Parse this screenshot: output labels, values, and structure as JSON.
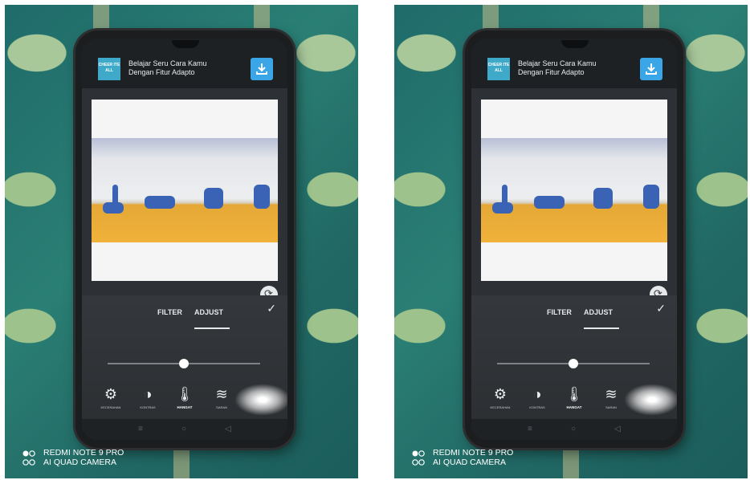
{
  "app": {
    "title_line1": "Belajar Seru Cara Kamu",
    "title_line2": "Dengan Fitur Adapto",
    "logo_text": "CHEER ITE ALL"
  },
  "editor": {
    "tabs": [
      "FILTER",
      "ADJUST"
    ],
    "active_tab": "ADJUST",
    "slider_value_fraction": 0.5,
    "tools": [
      {
        "icon": "gear-icon",
        "label": "KECERAHAN",
        "active": false
      },
      {
        "icon": "contrast-icon",
        "label": "KONTRAS",
        "active": false
      },
      {
        "icon": "thermometer-icon",
        "label": "HANGAT",
        "active": true
      },
      {
        "icon": "wifi-icon",
        "label": "SARAN",
        "active": false
      }
    ]
  },
  "watermark": {
    "line1": "REDMI NOTE 9 PRO",
    "line2": "AI QUAD CAMERA"
  },
  "colors": {
    "tablecloth": "#216864",
    "phone_body": "#1b1d1f",
    "judo_mat": "#f0b23a",
    "gi_blue": "#3b63b5",
    "save_button": "#3aa6e8"
  }
}
